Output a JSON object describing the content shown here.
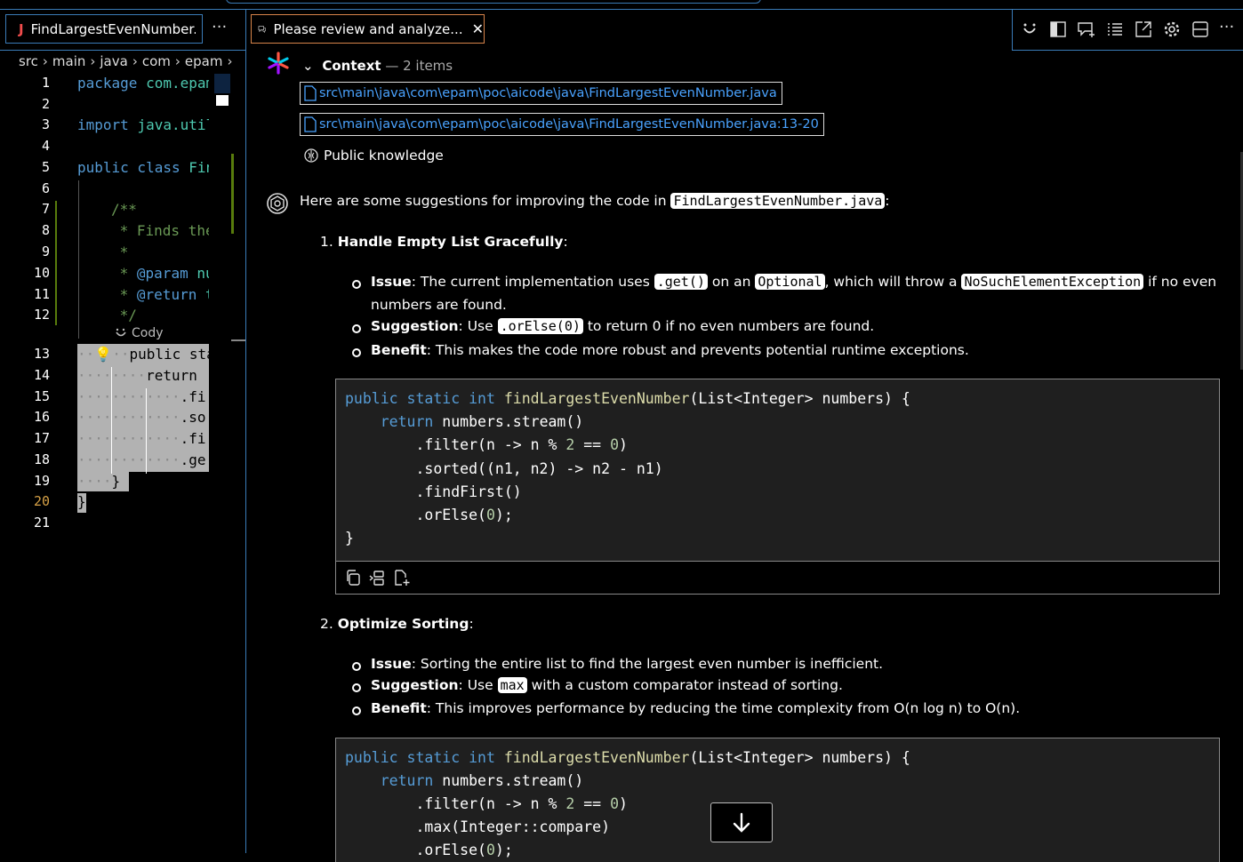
{
  "editor": {
    "tab_label": "FindLargestEvenNumber.ja",
    "tab_icon_letter": "J",
    "more": "···",
    "breadcrumb": [
      "src",
      "main",
      "java",
      "com",
      "epam"
    ],
    "line_numbers": [
      "1",
      "2",
      "3",
      "4",
      "5",
      "6",
      "7",
      "8",
      "9",
      "10",
      "11",
      "12",
      "13",
      "14",
      "15",
      "16",
      "17",
      "18",
      "19",
      "20",
      "21"
    ],
    "codelens": "Cody",
    "code": {
      "l1a": "package ",
      "l1b": "com.epam",
      "l3a": "import ",
      "l3b": "java.util",
      "l5a": "public class ",
      "l5b": "Fin",
      "l7": "/**",
      "l8": " * Finds the",
      "l9": " *",
      "l10a": " * ",
      "l10b": "@param",
      "l10c": " nu",
      "l11a": " * ",
      "l11b": "@return",
      "l11c": " t",
      "l12": " */",
      "l13": "public stati",
      "l14": "return",
      "l15": ".fi",
      "l16": ".so",
      "l17": ".fi",
      "l18": ".ge",
      "l19": "}",
      "l20": "}"
    }
  },
  "chat": {
    "tab_title": "Please review and analyze...",
    "context": {
      "label": "Context",
      "count": "— 2 items",
      "files": [
        "src\\main\\java\\com\\epam\\poc\\aicode\\java\\FindLargestEvenNumber.java",
        "src\\main\\java\\com\\epam\\poc\\aicode\\java\\FindLargestEvenNumber.java:13-20"
      ],
      "public_knowledge": "Public knowledge"
    },
    "intro": {
      "pre": "Here are some suggestions for improving the code in ",
      "code": "FindLargestEvenNumber.java",
      "post": ":"
    },
    "sections": [
      {
        "heading_num": "1.",
        "heading": "Handle Empty List Gracefully",
        "heading_colon": ":",
        "issue_label": "Issue",
        "issue_a": ": The current implementation uses ",
        "issue_c1": ".get()",
        "issue_b": " on an ",
        "issue_c2": "Optional",
        "issue_c": ", which will throw a ",
        "issue_c3": "NoSuchElementException",
        "issue_d": " if no even",
        "issue_wrap": "numbers are found.",
        "suggestion_label": "Suggestion",
        "suggestion_a": ": Use ",
        "suggestion_code": ".orElse(0)",
        "suggestion_b": " to return 0 if no even numbers are found.",
        "benefit_label": "Benefit",
        "benefit_text": ": This makes the code more robust and prevents potential runtime exceptions."
      },
      {
        "heading_num": "2.",
        "heading": "Optimize Sorting",
        "heading_colon": ":",
        "issue_label": "Issue",
        "issue_text": ": Sorting the entire list to find the largest even number is inefficient.",
        "suggestion_label": "Suggestion",
        "suggestion_a": ": Use ",
        "suggestion_code": "max",
        "suggestion_b": " with a custom comparator instead of sorting.",
        "benefit_label": "Benefit",
        "benefit_text": ": This improves performance by reducing the time complexity from O(n log n) to O(n)."
      }
    ],
    "code1": {
      "sig_kw": "public static int",
      "sig_fn": "findLargestEvenNumber",
      "sig_rest": "(List<Integer> numbers) {",
      "ret_kw": "return",
      "ret_rest": " numbers.stream()",
      "f1a": ".filter(n -> n % ",
      "f1n1": "2",
      "f1b": " == ",
      "f1n2": "0",
      "f1c": ")",
      "f2": ".sorted((n1, n2) -> n2 - n1)",
      "f3": ".findFirst()",
      "f4a": ".orElse(",
      "f4n": "0",
      "f4b": ");",
      "close": "}"
    },
    "code2": {
      "sig_kw": "public static int",
      "sig_fn": "findLargestEvenNumber",
      "sig_rest": "(List<Integer> numbers) {",
      "ret_kw": "return",
      "ret_rest": " numbers.stream()",
      "f1a": ".filter(n -> n % ",
      "f1n1": "2",
      "f1b": " == ",
      "f1n2": "0",
      "f1c": ")",
      "f2": ".max(Integer::compare)",
      "f3a": ".orElse(",
      "f3n": "0",
      "f3b": ");"
    }
  },
  "colors": {
    "accent": "#3a7bb7",
    "active_tab": "#d7844a",
    "link": "#4aa3ff",
    "selection": "#b2b2b2"
  }
}
